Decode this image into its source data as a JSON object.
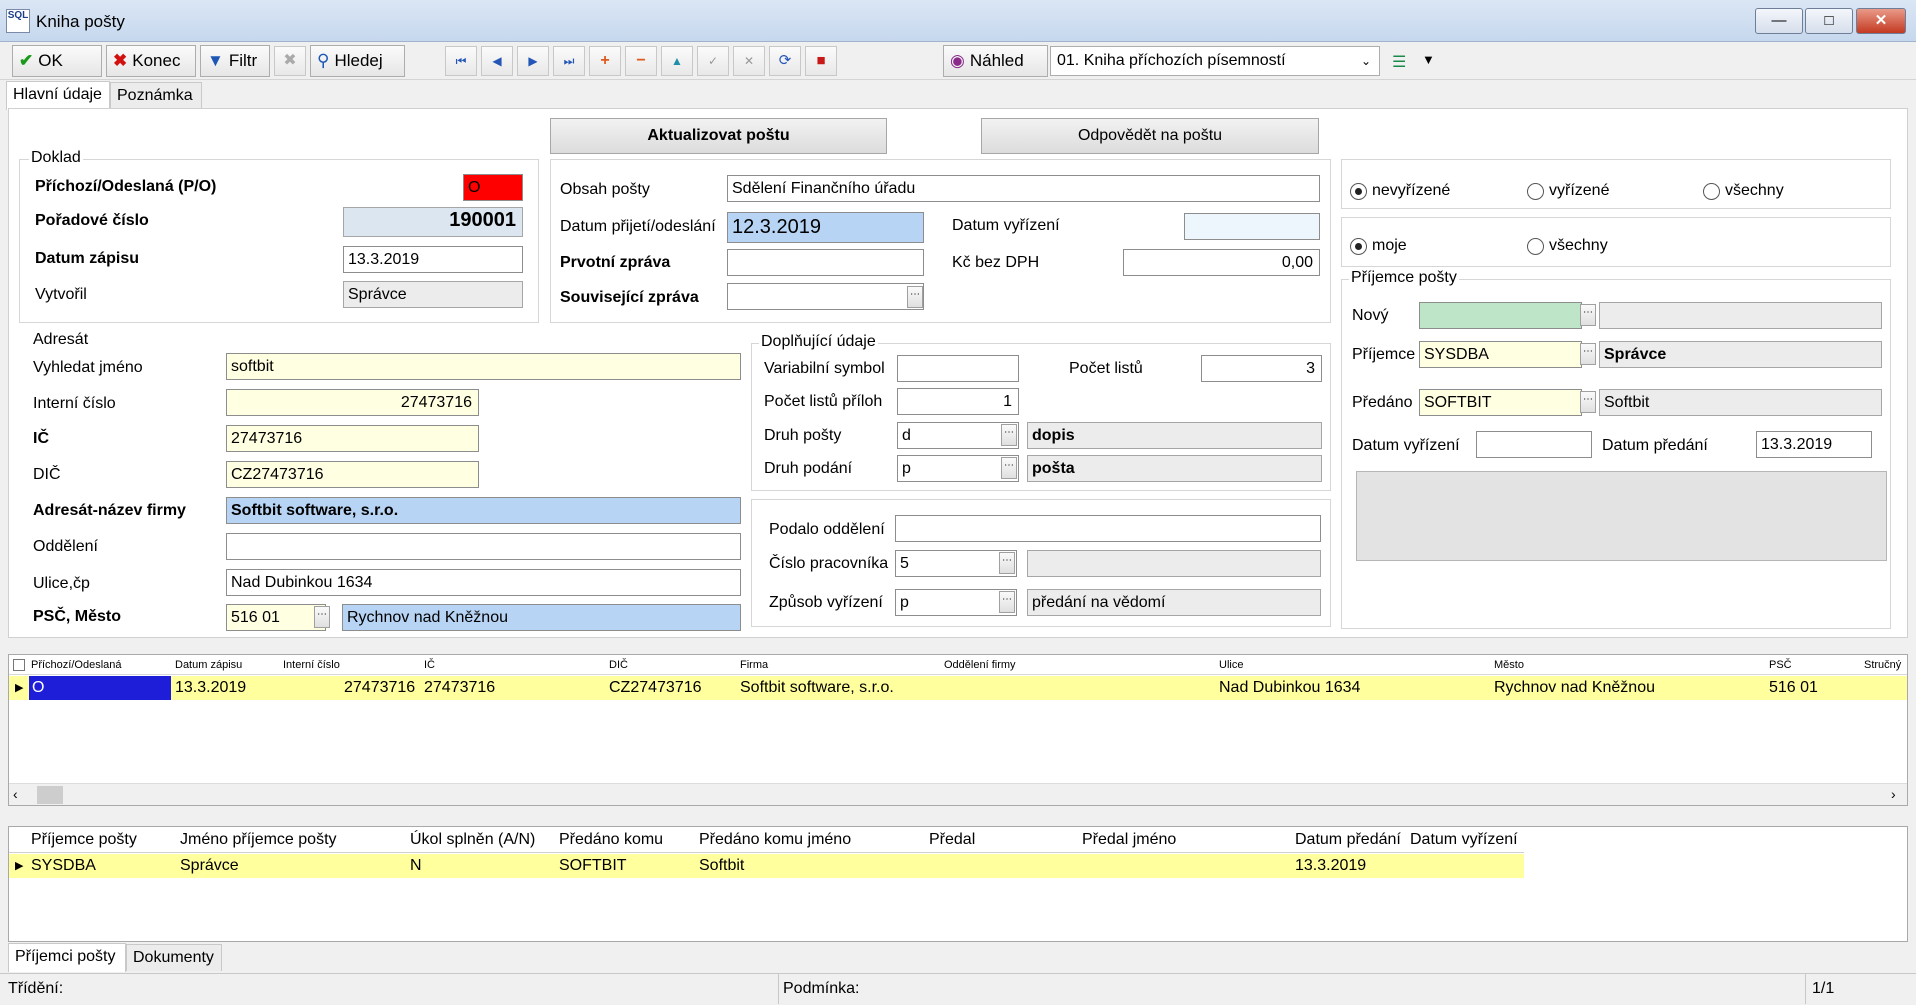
{
  "window": {
    "title": "Kniha pošty",
    "app_icon": "SQL"
  },
  "toolbar": {
    "ok": "OK",
    "konec": "Konec",
    "filtr": "Filtr",
    "hledej": "Hledej",
    "nahled": "Náhled",
    "book_select": "01. Kniha příchozích písemností"
  },
  "tabs": {
    "main": "Hlavní údaje",
    "note": "Poznámka"
  },
  "buttons": {
    "update": "Aktualizovat poštu",
    "reply": "Odpovědět na poštu"
  },
  "doklad": {
    "group": "Doklad",
    "po_label": "Příchozí/Odeslaná (P/O)",
    "po_value": "O",
    "order_label": "Pořadové číslo",
    "order_value": "190001",
    "date_label": "Datum zápisu",
    "date_value": "13.3.2019",
    "author_label": "Vytvořil",
    "author_value": "Správce"
  },
  "mail": {
    "content_label": "Obsah pošty",
    "content_value": "Sdělení Finančního úřadu",
    "recv_label": "Datum přijetí/odeslání",
    "recv_value": "12.3.2019",
    "resolve_label": "Datum vyřízení",
    "resolve_value": "",
    "first_label": "Prvotní zpráva",
    "first_value": "",
    "kc_label": "Kč bez DPH",
    "kc_value": "0,00",
    "related_label": "Související zpráva",
    "related_value": ""
  },
  "filters": {
    "r1": "nevyřízené",
    "r2": "vyřízené",
    "r3": "všechny",
    "r4": "moje",
    "r5": "všechny"
  },
  "recipients": {
    "group": "Příjemce pošty",
    "new_label": "Nový",
    "recip_label": "Příjemce",
    "recip_code": "SYSDBA",
    "recip_name": "Správce",
    "handed_label": "Předáno",
    "handed_code": "SOFTBIT",
    "handed_name": "Softbit",
    "resolve_label": "Datum vyřízení",
    "resolve_value": "",
    "handed_date_label": "Datum předání",
    "handed_date_value": "13.3.2019"
  },
  "addressee": {
    "group": "Adresát",
    "search_label": "Vyhledat jméno",
    "search_value": "softbit",
    "internal_label": "Interní číslo",
    "internal_value": "27473716",
    "ic_label": "IČ",
    "ic_value": "27473716",
    "dic_label": "DIČ",
    "dic_value": "CZ27473716",
    "firm_label": "Adresát-název firmy",
    "firm_value": "Softbit software, s.r.o.",
    "dept_label": "Oddělení",
    "dept_value": "",
    "street_label": "Ulice,čp",
    "street_value": "Nad Dubinkou 1634",
    "psc_label": "PSČ, Město",
    "psc_value": "516 01",
    "city_value": "Rychnov nad Kněžnou"
  },
  "extra": {
    "group": "Doplňující údaje",
    "var_label": "Variabilní symbol",
    "var_value": "",
    "sheets_label": "Počet listů",
    "sheets_value": "3",
    "att_label": "Počet listů příloh",
    "att_value": "1",
    "type_label": "Druh pošty",
    "type_code": "d",
    "type_name": "dopis",
    "sub_label": "Druh podání",
    "sub_code": "p",
    "sub_name": "pošta",
    "dept_label": "Podalo oddělení",
    "dept_value": "",
    "worker_label": "Číslo pracovníka",
    "worker_value": "5",
    "worker_name": "",
    "way_label": "Způsob vyřízení",
    "way_code": "p",
    "way_name": "předání na vědomí"
  },
  "grid1": {
    "headers": [
      "Příchozí/Odeslaná",
      "Datum zápisu",
      "Interní číslo",
      "IČ",
      "DIČ",
      "Firma",
      "Oddělení firmy",
      "Ulice",
      "Město",
      "PSČ",
      "Stručný"
    ],
    "row": [
      "O",
      "13.3.2019",
      "27473716",
      "27473716",
      "CZ27473716",
      "Softbit software, s.r.o.",
      "",
      "Nad Dubinkou 1634",
      "Rychnov nad Kněžnou",
      "516 01",
      ""
    ]
  },
  "grid2": {
    "headers": [
      "Příjemce pošty",
      "Jméno příjemce pošty",
      "Úkol splněn (A/N)",
      "Předáno komu",
      "Předáno komu jméno",
      "Předal",
      "Předal jméno",
      "Datum předání",
      "Datum vyřízení"
    ],
    "row": [
      "SYSDBA",
      "Správce",
      "N",
      "SOFTBIT",
      "Softbit",
      "",
      "",
      "13.3.2019",
      ""
    ]
  },
  "bottom_tabs": {
    "t1": "Příjemci pošty",
    "t2": "Dokumenty"
  },
  "status": {
    "sort": "Třídění:",
    "cond": "Podmínka:",
    "page": "1/1"
  },
  "colors": {
    "accent": "#b7d4f4",
    "row_highlight": "#ffff9e",
    "required": "#ffffe1",
    "red": "#ff0000"
  }
}
